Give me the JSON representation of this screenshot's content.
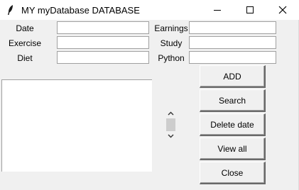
{
  "window": {
    "title": "MY myDatabase DATABASE"
  },
  "form": {
    "labels": {
      "date": "Date",
      "exercise": "Exercise",
      "diet": "Diet",
      "earnings": "Earnings",
      "study": "Study",
      "python": "Python"
    },
    "values": {
      "date": "",
      "exercise": "",
      "diet": "",
      "earnings": "",
      "study": "",
      "python": ""
    }
  },
  "listbox": {
    "items": []
  },
  "buttons": {
    "add": "ADD",
    "search": "Search",
    "delete": "Delete date",
    "view_all": "View all",
    "close": "Close"
  },
  "icons": {
    "app": "feather-icon",
    "minimize": "minimize-icon",
    "maximize": "maximize-icon",
    "close": "close-icon",
    "scroll_up": "chevron-up-icon",
    "scroll_down": "chevron-down-icon"
  }
}
